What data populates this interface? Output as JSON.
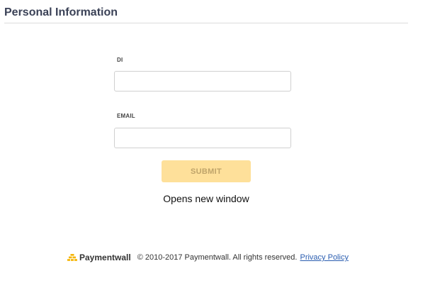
{
  "header": {
    "title": "Personal Information"
  },
  "form": {
    "di_label": "DI",
    "di_value": "",
    "email_label": "EMAIL",
    "email_value": "",
    "submit_label": "SUBMIT",
    "note": "Opens new window"
  },
  "footer": {
    "brand_icon": "paymentwall-logo-icon",
    "brand_name": "Paymentwall",
    "copyright": "© 2010-2017 Paymentwall. All rights reserved.",
    "privacy_label": "Privacy Policy"
  },
  "colors": {
    "title": "#3b4257",
    "submit_bg": "#fee09a",
    "submit_text": "#bfa46a",
    "logo": "#f5b400",
    "link": "#2a5db0"
  }
}
